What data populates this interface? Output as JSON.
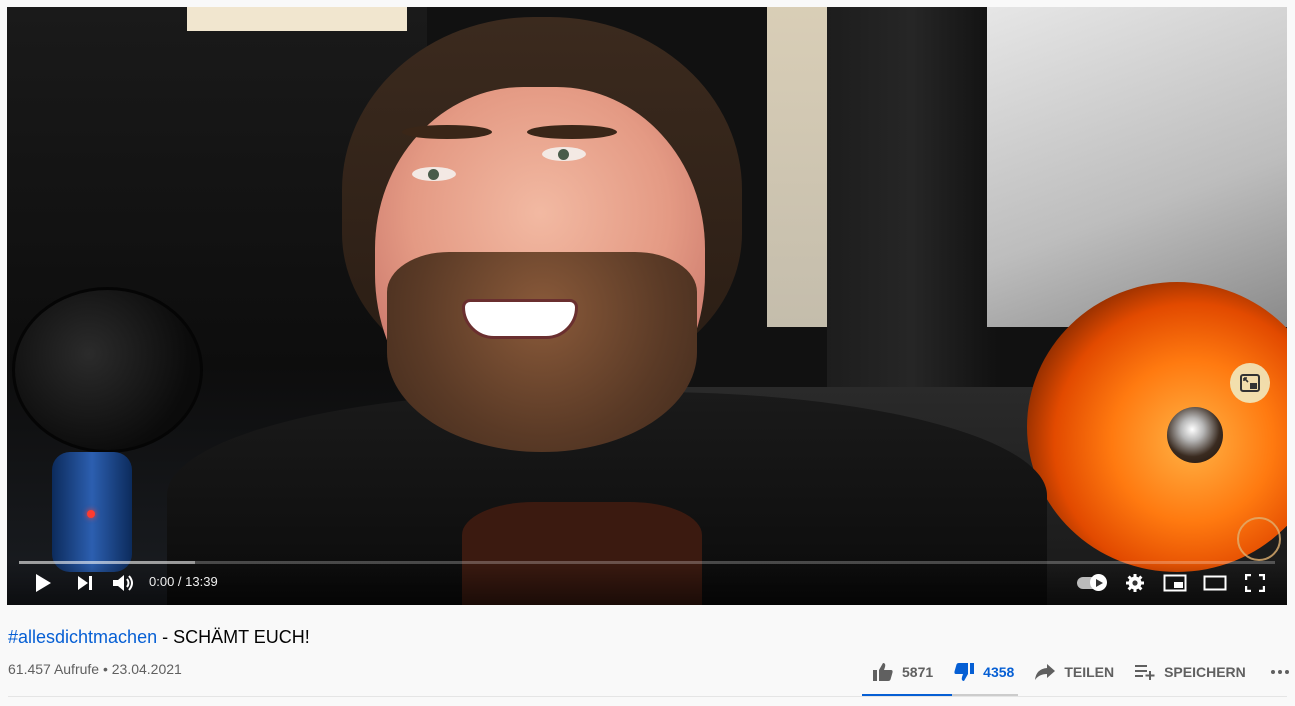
{
  "video": {
    "title_hashtag": "#allesdichtmachen",
    "title_rest": " - SCHÄMT EUCH!",
    "time_display": "0:00 / 13:39",
    "progress_buffered": 0.14
  },
  "meta": {
    "views_date": "61.457 Aufrufe • 23.04.2021"
  },
  "actions": {
    "likes": "5871",
    "dislikes": "4358",
    "share_label": "TEILEN",
    "save_label": "SPEICHERN"
  },
  "colors": {
    "link_blue": "#065fd4",
    "text_primary": "#030303",
    "text_secondary": "#606060"
  }
}
